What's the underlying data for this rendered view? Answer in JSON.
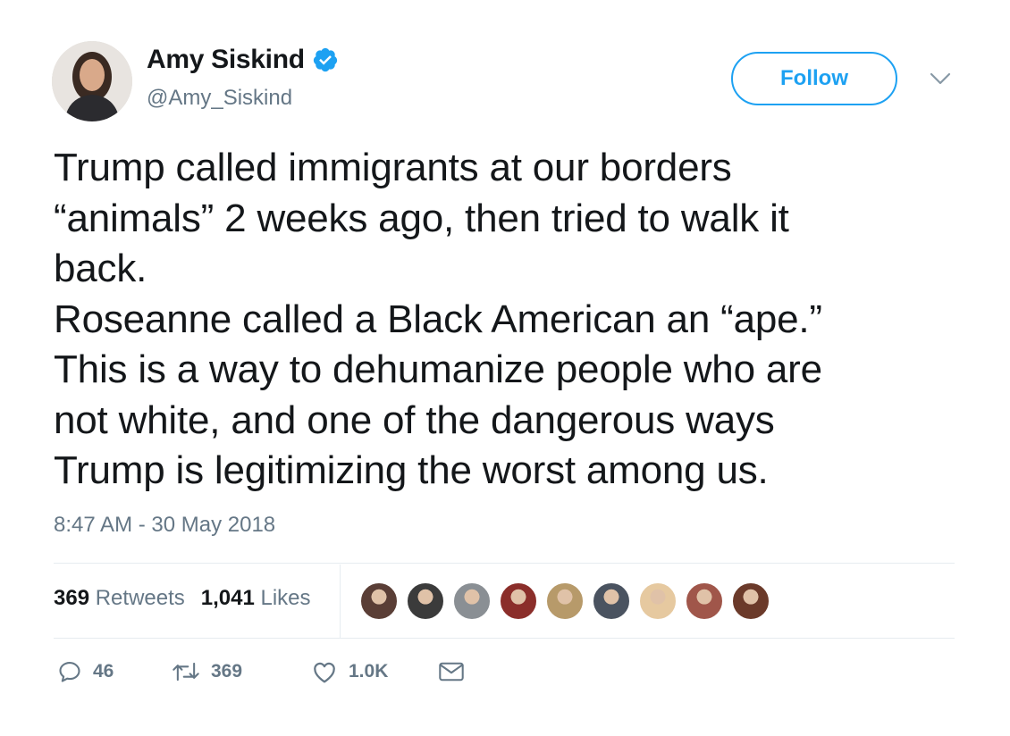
{
  "author": {
    "name": "Amy Siskind",
    "handle": "@Amy_Siskind",
    "verified": true
  },
  "follow_label": "Follow",
  "tweet_lines": [
    "Trump called immigrants at our borders",
    "“animals” 2 weeks ago, then tried to walk it",
    "back.",
    "Roseanne called a Black American an “ape.”",
    "This is a way to dehumanize people who are",
    "not white, and one of the dangerous ways",
    "Trump is legitimizing the worst among us."
  ],
  "timestamp": "8:47 AM - 30 May 2018",
  "stats": {
    "retweets_count": "369",
    "retweets_label": "Retweets",
    "likes_count": "1,041",
    "likes_label": "Likes"
  },
  "liker_avatars": [
    "#5a3e36",
    "#3b3b3b",
    "#8a8f94",
    "#8b2e2a",
    "#b79a6a",
    "#4a5360",
    "#e6c9a0",
    "#a0564a",
    "#6b3a2a"
  ],
  "actions": {
    "reply_count": "46",
    "retweet_count": "369",
    "like_count": "1.0K"
  },
  "colors": {
    "accent": "#1da1f2",
    "secondary_text": "#657786",
    "primary_text": "#14171a"
  }
}
